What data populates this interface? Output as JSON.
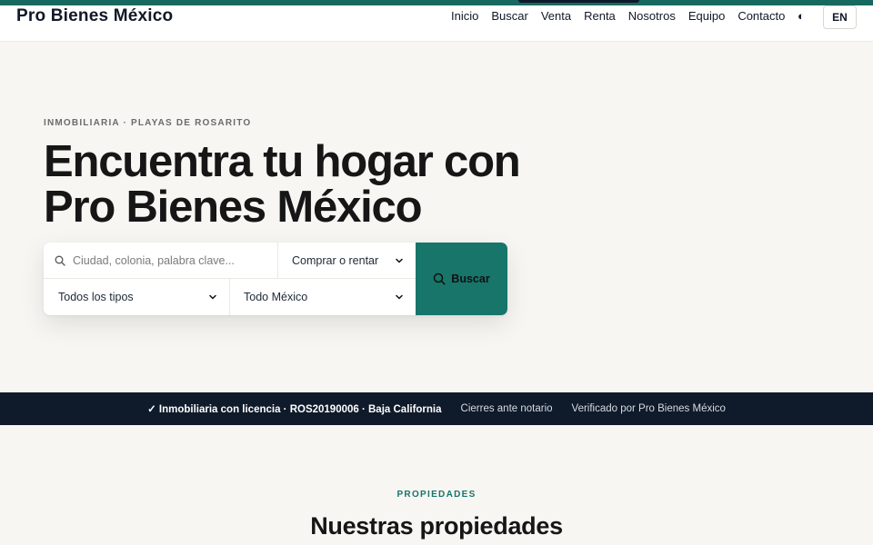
{
  "header": {
    "brand": "Pro Bienes México",
    "nav": [
      "Inicio",
      "Buscar",
      "Venta",
      "Renta",
      "Nosotros",
      "Equipo",
      "Contacto"
    ],
    "theme_icon": "◐",
    "lang_label": "EN"
  },
  "hero": {
    "eyebrow": "INMOBILIARIA · PLAYAS DE ROSARITO",
    "title_line1": "Encuentra tu hogar con",
    "title_line2": "Pro Bienes México"
  },
  "search": {
    "placeholder": "Ciudad, colonia, palabra clave...",
    "operation_value": "Comprar o rentar",
    "type_value": "Todos los tipos",
    "location_value": "Todo México",
    "button_label": "Buscar"
  },
  "trust": {
    "license": "✓ Inmobiliaria con licencia · ROS20190006 · Baja California",
    "notary": "Cierres ante notario",
    "verified": "Verificado por Pro Bienes México"
  },
  "properties": {
    "eyebrow": "PROPIEDADES",
    "title": "Nuestras propiedades"
  },
  "colors": {
    "accent": "#17756a",
    "dark": "#0f1a2a"
  },
  "icons": {
    "search": "search-icon",
    "chevron": "chevron-down-icon",
    "theme": "contrast-icon"
  }
}
